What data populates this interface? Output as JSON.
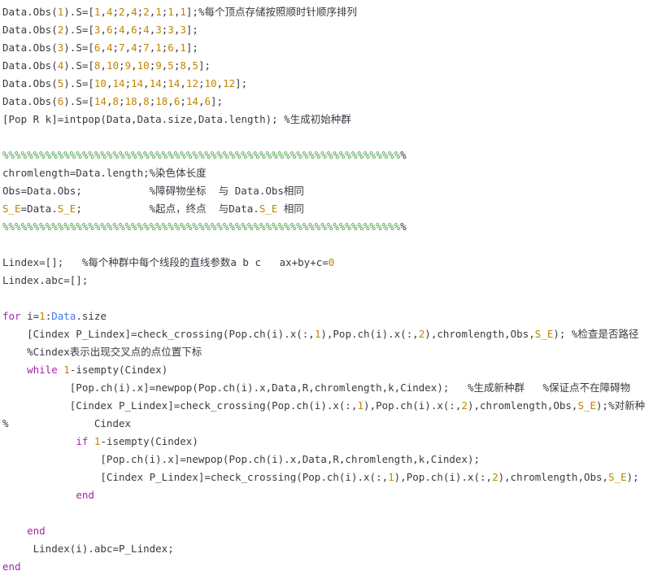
{
  "editor": {
    "lines": [
      {
        "tokens": [
          {
            "text": "Data.Obs(",
            "kind": "text"
          },
          {
            "text": "1",
            "kind": "num"
          },
          {
            "text": ").S=[",
            "kind": "text"
          },
          {
            "text": "1",
            "kind": "num"
          },
          {
            "text": ",",
            "kind": "text"
          },
          {
            "text": "4",
            "kind": "num"
          },
          {
            "text": ";",
            "kind": "text"
          },
          {
            "text": "2",
            "kind": "num"
          },
          {
            "text": ",",
            "kind": "text"
          },
          {
            "text": "4",
            "kind": "num"
          },
          {
            "text": ";",
            "kind": "text"
          },
          {
            "text": "2",
            "kind": "num"
          },
          {
            "text": ",",
            "kind": "text"
          },
          {
            "text": "1",
            "kind": "num"
          },
          {
            "text": ";",
            "kind": "text"
          },
          {
            "text": "1",
            "kind": "num"
          },
          {
            "text": ",",
            "kind": "text"
          },
          {
            "text": "1",
            "kind": "num"
          },
          {
            "text": "];",
            "kind": "text"
          },
          {
            "text": "%每个顶点存储按照顺时针顺序排列",
            "kind": "text"
          }
        ]
      },
      {
        "tokens": [
          {
            "text": "Data.Obs(",
            "kind": "text"
          },
          {
            "text": "2",
            "kind": "num"
          },
          {
            "text": ").S=[",
            "kind": "text"
          },
          {
            "text": "3",
            "kind": "num"
          },
          {
            "text": ",",
            "kind": "text"
          },
          {
            "text": "6",
            "kind": "num"
          },
          {
            "text": ";",
            "kind": "text"
          },
          {
            "text": "4",
            "kind": "num"
          },
          {
            "text": ",",
            "kind": "text"
          },
          {
            "text": "6",
            "kind": "num"
          },
          {
            "text": ";",
            "kind": "text"
          },
          {
            "text": "4",
            "kind": "num"
          },
          {
            "text": ",",
            "kind": "text"
          },
          {
            "text": "3",
            "kind": "num"
          },
          {
            "text": ";",
            "kind": "text"
          },
          {
            "text": "3",
            "kind": "num"
          },
          {
            "text": ",",
            "kind": "text"
          },
          {
            "text": "3",
            "kind": "num"
          },
          {
            "text": "];",
            "kind": "text"
          }
        ]
      },
      {
        "tokens": [
          {
            "text": "Data.Obs(",
            "kind": "text"
          },
          {
            "text": "3",
            "kind": "num"
          },
          {
            "text": ").S=[",
            "kind": "text"
          },
          {
            "text": "6",
            "kind": "num"
          },
          {
            "text": ",",
            "kind": "text"
          },
          {
            "text": "4",
            "kind": "num"
          },
          {
            "text": ";",
            "kind": "text"
          },
          {
            "text": "7",
            "kind": "num"
          },
          {
            "text": ",",
            "kind": "text"
          },
          {
            "text": "4",
            "kind": "num"
          },
          {
            "text": ";",
            "kind": "text"
          },
          {
            "text": "7",
            "kind": "num"
          },
          {
            "text": ",",
            "kind": "text"
          },
          {
            "text": "1",
            "kind": "num"
          },
          {
            "text": ";",
            "kind": "text"
          },
          {
            "text": "6",
            "kind": "num"
          },
          {
            "text": ",",
            "kind": "text"
          },
          {
            "text": "1",
            "kind": "num"
          },
          {
            "text": "];",
            "kind": "text"
          }
        ]
      },
      {
        "tokens": [
          {
            "text": "Data.Obs(",
            "kind": "text"
          },
          {
            "text": "4",
            "kind": "num"
          },
          {
            "text": ").S=[",
            "kind": "text"
          },
          {
            "text": "8",
            "kind": "num"
          },
          {
            "text": ",",
            "kind": "text"
          },
          {
            "text": "10",
            "kind": "num"
          },
          {
            "text": ";",
            "kind": "text"
          },
          {
            "text": "9",
            "kind": "num"
          },
          {
            "text": ",",
            "kind": "text"
          },
          {
            "text": "10",
            "kind": "num"
          },
          {
            "text": ";",
            "kind": "text"
          },
          {
            "text": "9",
            "kind": "num"
          },
          {
            "text": ",",
            "kind": "text"
          },
          {
            "text": "5",
            "kind": "num"
          },
          {
            "text": ";",
            "kind": "text"
          },
          {
            "text": "8",
            "kind": "num"
          },
          {
            "text": ",",
            "kind": "text"
          },
          {
            "text": "5",
            "kind": "num"
          },
          {
            "text": "];",
            "kind": "text"
          }
        ]
      },
      {
        "tokens": [
          {
            "text": "Data.Obs(",
            "kind": "text"
          },
          {
            "text": "5",
            "kind": "num"
          },
          {
            "text": ").S=[",
            "kind": "text"
          },
          {
            "text": "10",
            "kind": "num"
          },
          {
            "text": ",",
            "kind": "text"
          },
          {
            "text": "14",
            "kind": "num"
          },
          {
            "text": ";",
            "kind": "text"
          },
          {
            "text": "14",
            "kind": "num"
          },
          {
            "text": ",",
            "kind": "text"
          },
          {
            "text": "14",
            "kind": "num"
          },
          {
            "text": ";",
            "kind": "text"
          },
          {
            "text": "14",
            "kind": "num"
          },
          {
            "text": ",",
            "kind": "text"
          },
          {
            "text": "12",
            "kind": "num"
          },
          {
            "text": ";",
            "kind": "text"
          },
          {
            "text": "10",
            "kind": "num"
          },
          {
            "text": ",",
            "kind": "text"
          },
          {
            "text": "12",
            "kind": "num"
          },
          {
            "text": "];",
            "kind": "text"
          }
        ]
      },
      {
        "tokens": [
          {
            "text": "Data.Obs(",
            "kind": "text"
          },
          {
            "text": "6",
            "kind": "num"
          },
          {
            "text": ").S=[",
            "kind": "text"
          },
          {
            "text": "14",
            "kind": "num"
          },
          {
            "text": ",",
            "kind": "text"
          },
          {
            "text": "8",
            "kind": "num"
          },
          {
            "text": ";",
            "kind": "text"
          },
          {
            "text": "18",
            "kind": "num"
          },
          {
            "text": ",",
            "kind": "text"
          },
          {
            "text": "8",
            "kind": "num"
          },
          {
            "text": ";",
            "kind": "text"
          },
          {
            "text": "18",
            "kind": "num"
          },
          {
            "text": ",",
            "kind": "text"
          },
          {
            "text": "6",
            "kind": "num"
          },
          {
            "text": ";",
            "kind": "text"
          },
          {
            "text": "14",
            "kind": "num"
          },
          {
            "text": ",",
            "kind": "text"
          },
          {
            "text": "6",
            "kind": "num"
          },
          {
            "text": "];",
            "kind": "text"
          }
        ]
      },
      {
        "tokens": [
          {
            "text": "[Pop R k]=intpop(Data,Data.size,Data.length); %生成初始种群",
            "kind": "text"
          }
        ]
      },
      {
        "tokens": []
      },
      {
        "tokens": [
          {
            "text": "%%%%%%%%%%%%%%%%%%%%%%%%%%%%%%%%%%%%%%%%%%%%%%%%%%%%%%%%%%%%%%%%%",
            "kind": "cmt"
          },
          {
            "text": "%",
            "kind": "text"
          }
        ]
      },
      {
        "tokens": [
          {
            "text": "chromlength=Data.length;%染色体长度",
            "kind": "text"
          }
        ]
      },
      {
        "tokens": [
          {
            "text": "Obs=Data.Obs;           %障碍物坐标  与 Data.Obs相同",
            "kind": "text"
          }
        ]
      },
      {
        "tokens": [
          {
            "text": "S_E",
            "kind": "num"
          },
          {
            "text": "=Data.",
            "kind": "text"
          },
          {
            "text": "S_E",
            "kind": "num"
          },
          {
            "text": ";           %起点，终点  与Data.",
            "kind": "text"
          },
          {
            "text": "S_E",
            "kind": "num"
          },
          {
            "text": " 相同",
            "kind": "text"
          }
        ]
      },
      {
        "tokens": [
          {
            "text": "%%%%%%%%%%%%%%%%%%%%%%%%%%%%%%%%%%%%%%%%%%%%%%%%%%%%%%%%%%%%%%%%%",
            "kind": "cmt"
          },
          {
            "text": "%",
            "kind": "text"
          }
        ]
      },
      {
        "tokens": []
      },
      {
        "tokens": [
          {
            "text": "Lindex=[];   %每个种群中每个线段的直线参数a b c   ax+by+c=",
            "kind": "text"
          },
          {
            "text": "0",
            "kind": "num"
          }
        ]
      },
      {
        "tokens": [
          {
            "text": "Lindex.abc=[];",
            "kind": "text"
          }
        ]
      },
      {
        "tokens": []
      },
      {
        "tokens": [
          {
            "text": "for",
            "kind": "kw"
          },
          {
            "text": " i=",
            "kind": "text"
          },
          {
            "text": "1",
            "kind": "num"
          },
          {
            "text": ":",
            "kind": "text"
          },
          {
            "text": "Data",
            "kind": "fn"
          },
          {
            "text": ".size",
            "kind": "text"
          }
        ]
      },
      {
        "tokens": [
          {
            "text": "    [Cindex P_Lindex]=check_crossing(Pop.ch(i).x(:,",
            "kind": "text"
          },
          {
            "text": "1",
            "kind": "num"
          },
          {
            "text": "),Pop.ch(i).x(:,",
            "kind": "text"
          },
          {
            "text": "2",
            "kind": "num"
          },
          {
            "text": "),chromlength,Obs,",
            "kind": "text"
          },
          {
            "text": "S_E",
            "kind": "num"
          },
          {
            "text": "); %检查是否路径",
            "kind": "text"
          }
        ]
      },
      {
        "tokens": [
          {
            "text": "    %Cindex表示出现交叉点的点位置下标",
            "kind": "text"
          }
        ]
      },
      {
        "tokens": [
          {
            "text": "    ",
            "kind": "text"
          },
          {
            "text": "while",
            "kind": "kw"
          },
          {
            "text": " ",
            "kind": "text"
          },
          {
            "text": "1",
            "kind": "num"
          },
          {
            "text": "-isempty(Cindex)",
            "kind": "text"
          }
        ]
      },
      {
        "tokens": [
          {
            "text": "           [Pop.ch(i).x]=newpop(Pop.ch(i).x,Data,R,chromlength,k,Cindex);   %生成新种群   %保证点不在障碍物",
            "kind": "text"
          }
        ]
      },
      {
        "tokens": [
          {
            "text": "           [Cindex P_Lindex]=check_crossing(Pop.ch(i).x(:,",
            "kind": "text"
          },
          {
            "text": "1",
            "kind": "num"
          },
          {
            "text": "),Pop.ch(i).x(:,",
            "kind": "text"
          },
          {
            "text": "2",
            "kind": "num"
          },
          {
            "text": "),chromlength,Obs,",
            "kind": "text"
          },
          {
            "text": "S_E",
            "kind": "num"
          },
          {
            "text": ");%对新种",
            "kind": "text"
          }
        ]
      },
      {
        "tokens": [
          {
            "text": "%              Cindex",
            "kind": "text"
          }
        ]
      },
      {
        "tokens": [
          {
            "text": "            ",
            "kind": "text"
          },
          {
            "text": "if",
            "kind": "kw"
          },
          {
            "text": " ",
            "kind": "text"
          },
          {
            "text": "1",
            "kind": "num"
          },
          {
            "text": "-isempty(Cindex)",
            "kind": "text"
          }
        ]
      },
      {
        "tokens": [
          {
            "text": "                [Pop.ch(i).x]=newpop(Pop.ch(i).x,Data,R,chromlength,k,Cindex);",
            "kind": "text"
          }
        ]
      },
      {
        "tokens": [
          {
            "text": "                [Cindex P_Lindex]=check_crossing(Pop.ch(i).x(:,",
            "kind": "text"
          },
          {
            "text": "1",
            "kind": "num"
          },
          {
            "text": "),Pop.ch(i).x(:,",
            "kind": "text"
          },
          {
            "text": "2",
            "kind": "num"
          },
          {
            "text": "),chromlength,Obs,",
            "kind": "text"
          },
          {
            "text": "S_E",
            "kind": "num"
          },
          {
            "text": ");",
            "kind": "text"
          }
        ]
      },
      {
        "tokens": [
          {
            "text": "            ",
            "kind": "text"
          },
          {
            "text": "end",
            "kind": "kw"
          }
        ]
      },
      {
        "tokens": []
      },
      {
        "tokens": [
          {
            "text": "    ",
            "kind": "text"
          },
          {
            "text": "end",
            "kind": "kw"
          }
        ]
      },
      {
        "tokens": [
          {
            "text": "     Lindex(i).abc=P_Lindex;",
            "kind": "text"
          }
        ]
      },
      {
        "tokens": [
          {
            "text": "end",
            "kind": "kw"
          }
        ]
      }
    ]
  },
  "colors": {
    "text": "#383a42",
    "number": "#c18401",
    "comment_bar": "#50a14f",
    "keyword": "#a626a4",
    "builtin": "#4078f2",
    "background": "#ffffff"
  }
}
